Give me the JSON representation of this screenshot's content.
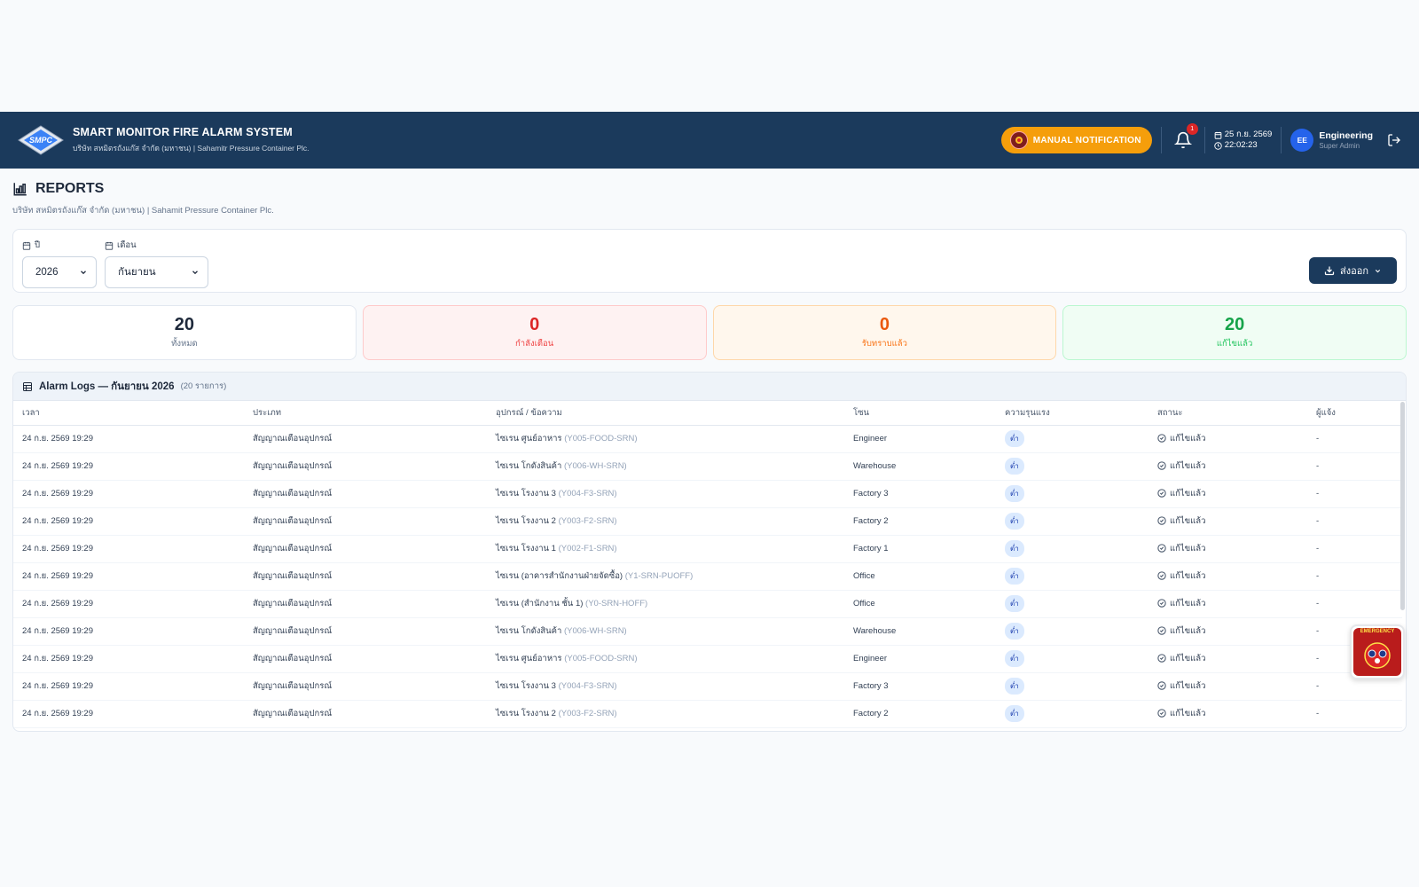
{
  "header": {
    "title": "SMART MONITOR FIRE ALARM SYSTEM",
    "subtitle": "บริษัท สหมิตรถังแก๊ส จำกัด (มหาชน) | Sahamitr Pressure Container Plc.",
    "logo_text": "SMPC",
    "manual_label": "MANUAL NOTIFICATION",
    "notification_count": "1",
    "date": "25 ก.ย. 2569",
    "time": "22:02:23",
    "user_initials": "EE",
    "user_name": "Engineering",
    "user_role": "Super Admin"
  },
  "page": {
    "title": "REPORTS",
    "subtitle": "บริษัท สหมิตรถังแก๊ส จำกัด (มหาชน) | Sahamit Pressure Container Plc."
  },
  "filters": {
    "year_label": "ปี",
    "year_value": "2026",
    "month_label": "เดือน",
    "month_value": "กันยายน",
    "export_label": "ส่งออก"
  },
  "stats": {
    "total": {
      "value": "20",
      "label": "ทั้งหมด"
    },
    "warning": {
      "value": "0",
      "label": "กำลังเตือน"
    },
    "acknowledged": {
      "value": "0",
      "label": "รับทราบแล้ว"
    },
    "resolved": {
      "value": "20",
      "label": "แก้ไขแล้ว"
    }
  },
  "logs": {
    "title": "Alarm Logs — กันยายน 2026",
    "count": "(20 รายการ)",
    "columns": [
      "เวลา",
      "ประเภท",
      "อุปกรณ์ / ข้อความ",
      "โซน",
      "ความรุนแรง",
      "สถานะ",
      "ผู้แจ้ง"
    ],
    "rows": [
      {
        "time": "24 ก.ย. 2569 19:29",
        "type": "สัญญาณเตือนอุปกรณ์",
        "device": "ไซเรน ศูนย์อาหาร",
        "code": "(Y005-FOOD-SRN)",
        "zone": "Engineer",
        "severity": "ต่ำ",
        "status": "แก้ไขแล้ว",
        "reporter": "-"
      },
      {
        "time": "24 ก.ย. 2569 19:29",
        "type": "สัญญาณเตือนอุปกรณ์",
        "device": "ไซเรน โกดังสินค้า",
        "code": "(Y006-WH-SRN)",
        "zone": "Warehouse",
        "severity": "ต่ำ",
        "status": "แก้ไขแล้ว",
        "reporter": "-"
      },
      {
        "time": "24 ก.ย. 2569 19:29",
        "type": "สัญญาณเตือนอุปกรณ์",
        "device": "ไซเรน โรงงาน 3",
        "code": "(Y004-F3-SRN)",
        "zone": "Factory 3",
        "severity": "ต่ำ",
        "status": "แก้ไขแล้ว",
        "reporter": "-"
      },
      {
        "time": "24 ก.ย. 2569 19:29",
        "type": "สัญญาณเตือนอุปกรณ์",
        "device": "ไซเรน โรงงาน 2",
        "code": "(Y003-F2-SRN)",
        "zone": "Factory 2",
        "severity": "ต่ำ",
        "status": "แก้ไขแล้ว",
        "reporter": "-"
      },
      {
        "time": "24 ก.ย. 2569 19:29",
        "type": "สัญญาณเตือนอุปกรณ์",
        "device": "ไซเรน โรงงาน 1",
        "code": "(Y002-F1-SRN)",
        "zone": "Factory 1",
        "severity": "ต่ำ",
        "status": "แก้ไขแล้ว",
        "reporter": "-"
      },
      {
        "time": "24 ก.ย. 2569 19:29",
        "type": "สัญญาณเตือนอุปกรณ์",
        "device": "ไซเรน (อาคารสำนักงานฝ่ายจัดซื้อ)",
        "code": "(Y1-SRN-PUOFF)",
        "zone": "Office",
        "severity": "ต่ำ",
        "status": "แก้ไขแล้ว",
        "reporter": "-"
      },
      {
        "time": "24 ก.ย. 2569 19:29",
        "type": "สัญญาณเตือนอุปกรณ์",
        "device": "ไซเรน (สำนักงาน ชั้น 1)",
        "code": "(Y0-SRN-HOFF)",
        "zone": "Office",
        "severity": "ต่ำ",
        "status": "แก้ไขแล้ว",
        "reporter": "-"
      },
      {
        "time": "24 ก.ย. 2569 19:29",
        "type": "สัญญาณเตือนอุปกรณ์",
        "device": "ไซเรน โกดังสินค้า",
        "code": "(Y006-WH-SRN)",
        "zone": "Warehouse",
        "severity": "ต่ำ",
        "status": "แก้ไขแล้ว",
        "reporter": "-"
      },
      {
        "time": "24 ก.ย. 2569 19:29",
        "type": "สัญญาณเตือนอุปกรณ์",
        "device": "ไซเรน ศูนย์อาหาร",
        "code": "(Y005-FOOD-SRN)",
        "zone": "Engineer",
        "severity": "ต่ำ",
        "status": "แก้ไขแล้ว",
        "reporter": "-"
      },
      {
        "time": "24 ก.ย. 2569 19:29",
        "type": "สัญญาณเตือนอุปกรณ์",
        "device": "ไซเรน โรงงาน 3",
        "code": "(Y004-F3-SRN)",
        "zone": "Factory 3",
        "severity": "ต่ำ",
        "status": "แก้ไขแล้ว",
        "reporter": "-"
      },
      {
        "time": "24 ก.ย. 2569 19:29",
        "type": "สัญญาณเตือนอุปกรณ์",
        "device": "ไซเรน โรงงาน 2",
        "code": "(Y003-F2-SRN)",
        "zone": "Factory 2",
        "severity": "ต่ำ",
        "status": "แก้ไขแล้ว",
        "reporter": "-"
      }
    ]
  },
  "emergency": {
    "label": "EMERGENCY"
  },
  "colors": {
    "header_bg": "#1b3a5c",
    "manual_btn": "#f59e0b",
    "warning": "#dc2626",
    "ack": "#ea580c",
    "resolved": "#16a34a"
  }
}
